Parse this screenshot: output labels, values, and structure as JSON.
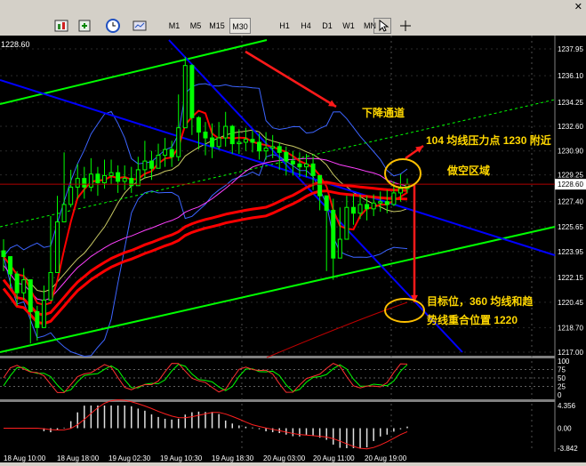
{
  "toolbar": {
    "timeframes": [
      "M1",
      "M5",
      "M15",
      "M30",
      "H1",
      "H4",
      "D1",
      "W1",
      "MN"
    ],
    "active_timeframe": "M30",
    "window_controls": [
      "minimize-icon",
      "restore-icon",
      "close-icon"
    ],
    "tool_icons": [
      "chart-wizard-icon",
      "clock-icon",
      "template-icon",
      "cursor-icon",
      "crosshair-icon"
    ]
  },
  "chart_data": {
    "type": "line",
    "title": "",
    "symbol_corner_label": "1228.60",
    "xlabel": "",
    "ylabel": "",
    "main_panel": {
      "price_axis_ticks": [
        "1237.95",
        "1236.10",
        "1234.25",
        "1232.60",
        "1230.90",
        "1229.25",
        "1228.60",
        "1227.40",
        "1225.65",
        "1223.95",
        "1222.15",
        "1220.45",
        "1218.70",
        "1217.00"
      ],
      "current_price": "1228.60",
      "ylim": [
        1217.0,
        1238.5
      ],
      "candles": {
        "note_free": true,
        "closes": [
          1223.6,
          1222.4,
          1221.1,
          1222.0,
          1219.8,
          1218.7,
          1220.6,
          1222.5,
          1226.0,
          1227.2,
          1228.4,
          1229.0,
          1228.4,
          1229.3,
          1228.7,
          1229.2,
          1229.4,
          1228.8,
          1229.0,
          1228.5,
          1229.6,
          1230.2,
          1229.7,
          1230.6,
          1231.0,
          1230.5,
          1232.5,
          1236.8,
          1233.2,
          1232.2,
          1231.8,
          1231.2,
          1231.8,
          1232.6,
          1231.4,
          1231.5,
          1231.7,
          1231.5,
          1230.9,
          1231.1,
          1231.2,
          1230.8,
          1230.2,
          1230.0,
          1229.8,
          1230.0,
          1229.2,
          1227.8,
          1226.8,
          1223.5,
          1224.8,
          1227.0,
          1226.6,
          1227.2,
          1226.9,
          1227.3,
          1227.4,
          1227.2,
          1228.0,
          1228.3,
          1228.6
        ],
        "highs": [
          1224.8,
          1223.2,
          1222.6,
          1222.8,
          1221.0,
          1220.2,
          1221.6,
          1226.4,
          1227.8,
          1230.8,
          1229.6,
          1230.0,
          1229.8,
          1230.4,
          1229.8,
          1230.3,
          1230.3,
          1229.9,
          1229.9,
          1229.8,
          1230.5,
          1231.6,
          1230.9,
          1231.4,
          1231.8,
          1231.6,
          1234.8,
          1237.4,
          1236.9,
          1233.3,
          1232.9,
          1232.8,
          1232.9,
          1233.6,
          1232.7,
          1232.4,
          1232.5,
          1232.3,
          1232.1,
          1232.2,
          1232.0,
          1231.5,
          1231.2,
          1230.9,
          1230.8,
          1230.7,
          1230.5,
          1229.2,
          1227.8,
          1227.6,
          1227.0,
          1227.8,
          1227.9,
          1227.9,
          1227.8,
          1227.9,
          1228.1,
          1228.2,
          1228.8,
          1229.3,
          1229.0
        ],
        "lows": [
          1222.6,
          1221.4,
          1220.2,
          1220.6,
          1217.6,
          1217.8,
          1218.8,
          1221.2,
          1224.4,
          1226.2,
          1227.0,
          1227.6,
          1227.6,
          1228.1,
          1227.8,
          1228.3,
          1228.6,
          1228.0,
          1228.2,
          1228.0,
          1228.6,
          1229.0,
          1228.9,
          1229.7,
          1229.8,
          1229.8,
          1230.2,
          1232.8,
          1232.0,
          1231.0,
          1230.6,
          1230.4,
          1231.0,
          1231.2,
          1230.7,
          1230.7,
          1230.9,
          1230.8,
          1230.3,
          1230.3,
          1230.4,
          1229.6,
          1229.2,
          1229.2,
          1229.1,
          1229.1,
          1228.2,
          1226.8,
          1222.6,
          1222.0,
          1223.6,
          1225.6,
          1225.8,
          1226.2,
          1226.1,
          1226.4,
          1226.7,
          1226.6,
          1227.1,
          1227.4,
          1228.0
        ]
      },
      "annotations": {
        "down_channel": "下降通道",
        "resistance": "104 均线压力点 1230 附近",
        "short_zone": "做空区域",
        "target_line1": "目标位，360 均线和趋",
        "target_line2": "势线重合位置 1220"
      },
      "colors": {
        "background": "#000000",
        "candle": "#00ff00",
        "ma_red": "#ff0000",
        "ma_darkred": "#c00000",
        "ma_yellow": "#c8c864",
        "ma_magenta": "#ff40ff",
        "bollinger": "#3c64ff",
        "channel_blue": "#0000ff",
        "channel_green": "#00ff00",
        "arrow": "#ff1a1a",
        "annotation_text": "#ffd700",
        "circle": "#ffc000"
      }
    },
    "stochastic_panel": {
      "axis_ticks": [
        "100",
        "75",
        "50",
        "25",
        "0"
      ],
      "colors": {
        "main": "#ff3030",
        "signal": "#00ff00"
      }
    },
    "macd_panel": {
      "axis_ticks": [
        "4.356",
        "0.00",
        "-3.842"
      ],
      "colors": {
        "histogram": "#e0e0e0",
        "signal": "#ff2020"
      }
    },
    "time_axis": [
      "18 Aug 10:00",
      "18 Aug 18:00",
      "19 Aug 02:30",
      "19 Aug 10:30",
      "19 Aug 18:30",
      "20 Aug 03:00",
      "20 Aug 11:00",
      "20 Aug 19:00"
    ]
  }
}
